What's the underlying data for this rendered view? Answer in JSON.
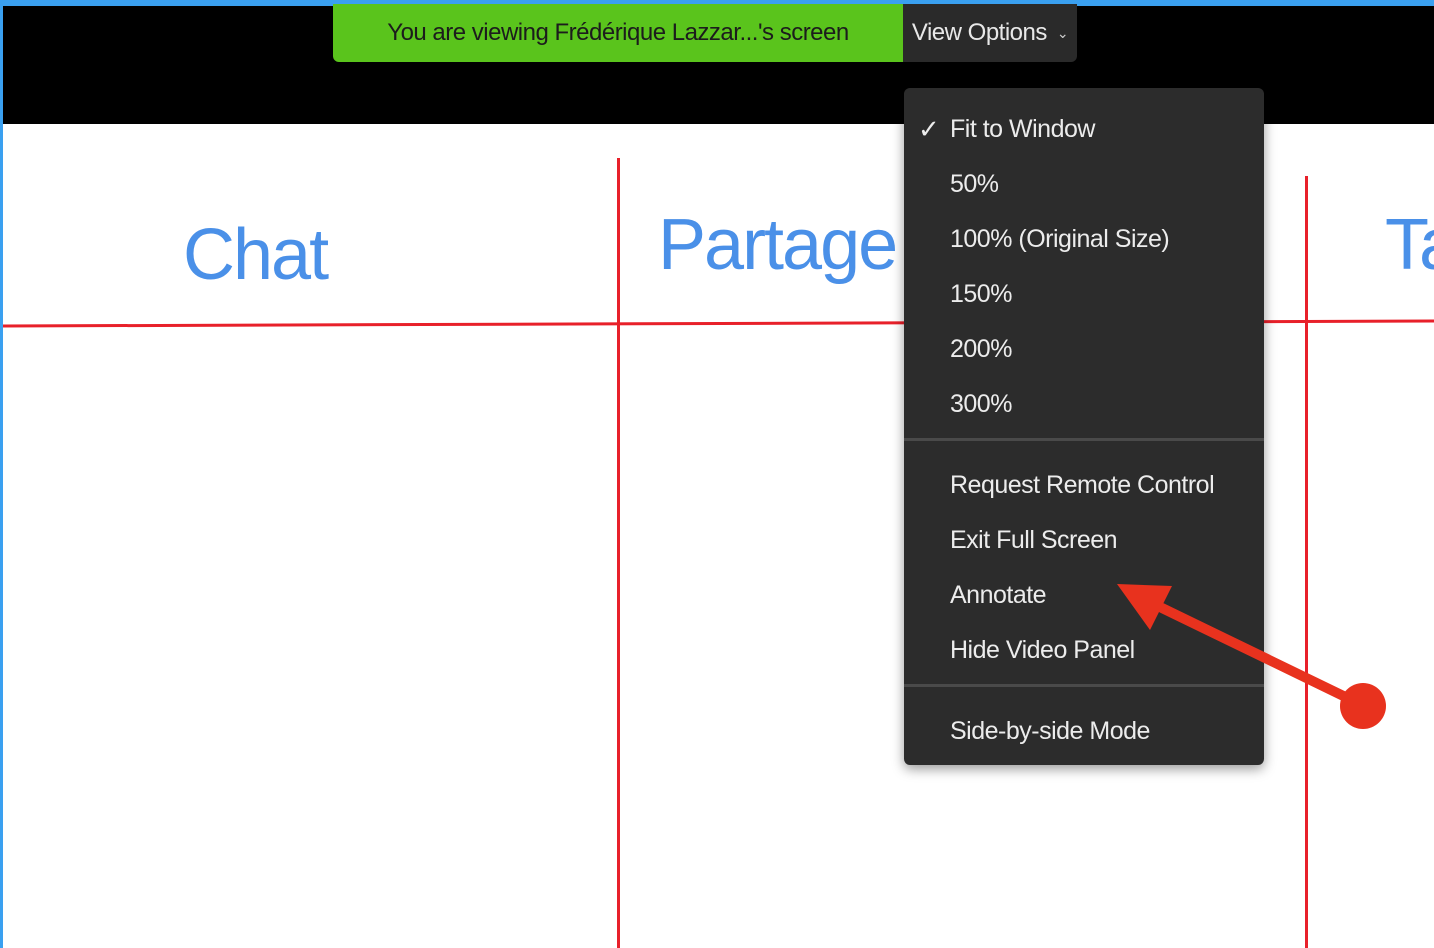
{
  "banner": {
    "viewing_text": "You are viewing Frédérique Lazzar...'s screen",
    "view_options_label": "View Options",
    "view_options_chevron": "⌄"
  },
  "slide": {
    "col1_heading": "Chat",
    "col2_heading": "Partage d'écran",
    "col3_heading": "Ta"
  },
  "menu": {
    "checkmark": "✓",
    "zoom_items": [
      "Fit to Window",
      "50%",
      "100% (Original Size)",
      "150%",
      "200%",
      "300%"
    ],
    "action_items": [
      "Request Remote Control",
      "Exit Full Screen",
      "Annotate",
      "Hide Video Panel"
    ],
    "mode_items": [
      "Side-by-side Mode"
    ],
    "selected": "Fit to Window"
  },
  "colors": {
    "frame": "#3aa0f0",
    "banner_green": "#5ac41c",
    "heading_blue": "#4a90e8",
    "grid_red": "#e8202a",
    "menu_bg": "#2c2c2c",
    "arrow_red": "#e8321e"
  },
  "annotation": {
    "arrow_target": "Annotate"
  }
}
